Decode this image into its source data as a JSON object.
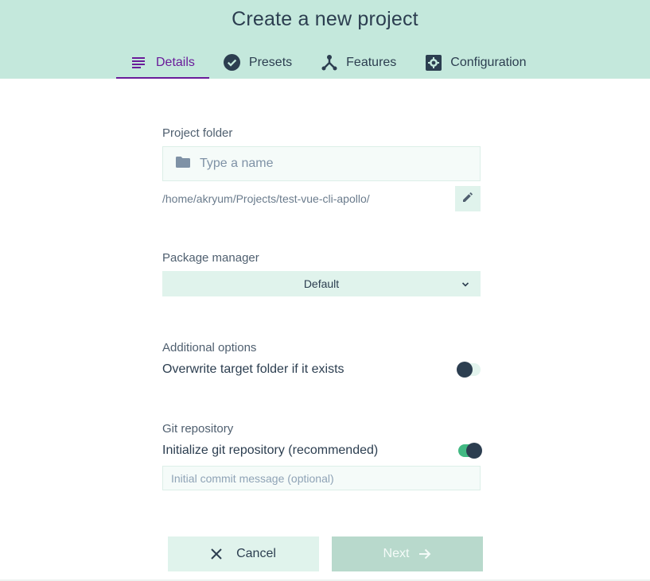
{
  "header": {
    "title": "Create a new project",
    "tabs": [
      {
        "label": "Details",
        "icon": "subject-icon",
        "active": true
      },
      {
        "label": "Presets",
        "icon": "check-circle-icon",
        "active": false
      },
      {
        "label": "Features",
        "icon": "device-hub-icon",
        "active": false
      },
      {
        "label": "Configuration",
        "icon": "settings-applications-icon",
        "active": false
      }
    ]
  },
  "project_folder": {
    "label": "Project folder",
    "placeholder": "Type a name",
    "value": "",
    "path": "/home/akryum/Projects/test-vue-cli-apollo/"
  },
  "package_manager": {
    "label": "Package manager",
    "selected": "Default"
  },
  "additional_options": {
    "label": "Additional options",
    "overwrite_label": "Overwrite target folder if it exists",
    "overwrite_enabled": false
  },
  "git": {
    "label": "Git repository",
    "init_label": "Initialize git repository (recommended)",
    "init_enabled": true,
    "commit_placeholder": "Initial commit message (optional)"
  },
  "actions": {
    "cancel_label": "Cancel",
    "next_label": "Next"
  },
  "colors": {
    "header_bg": "#c4e8dc",
    "active_tab": "#6a1b9a",
    "text": "#2c3e50",
    "accent_green": "#42b983",
    "button_bg": "#e0f3ec",
    "disabled_button_bg": "#b8d9cc"
  }
}
